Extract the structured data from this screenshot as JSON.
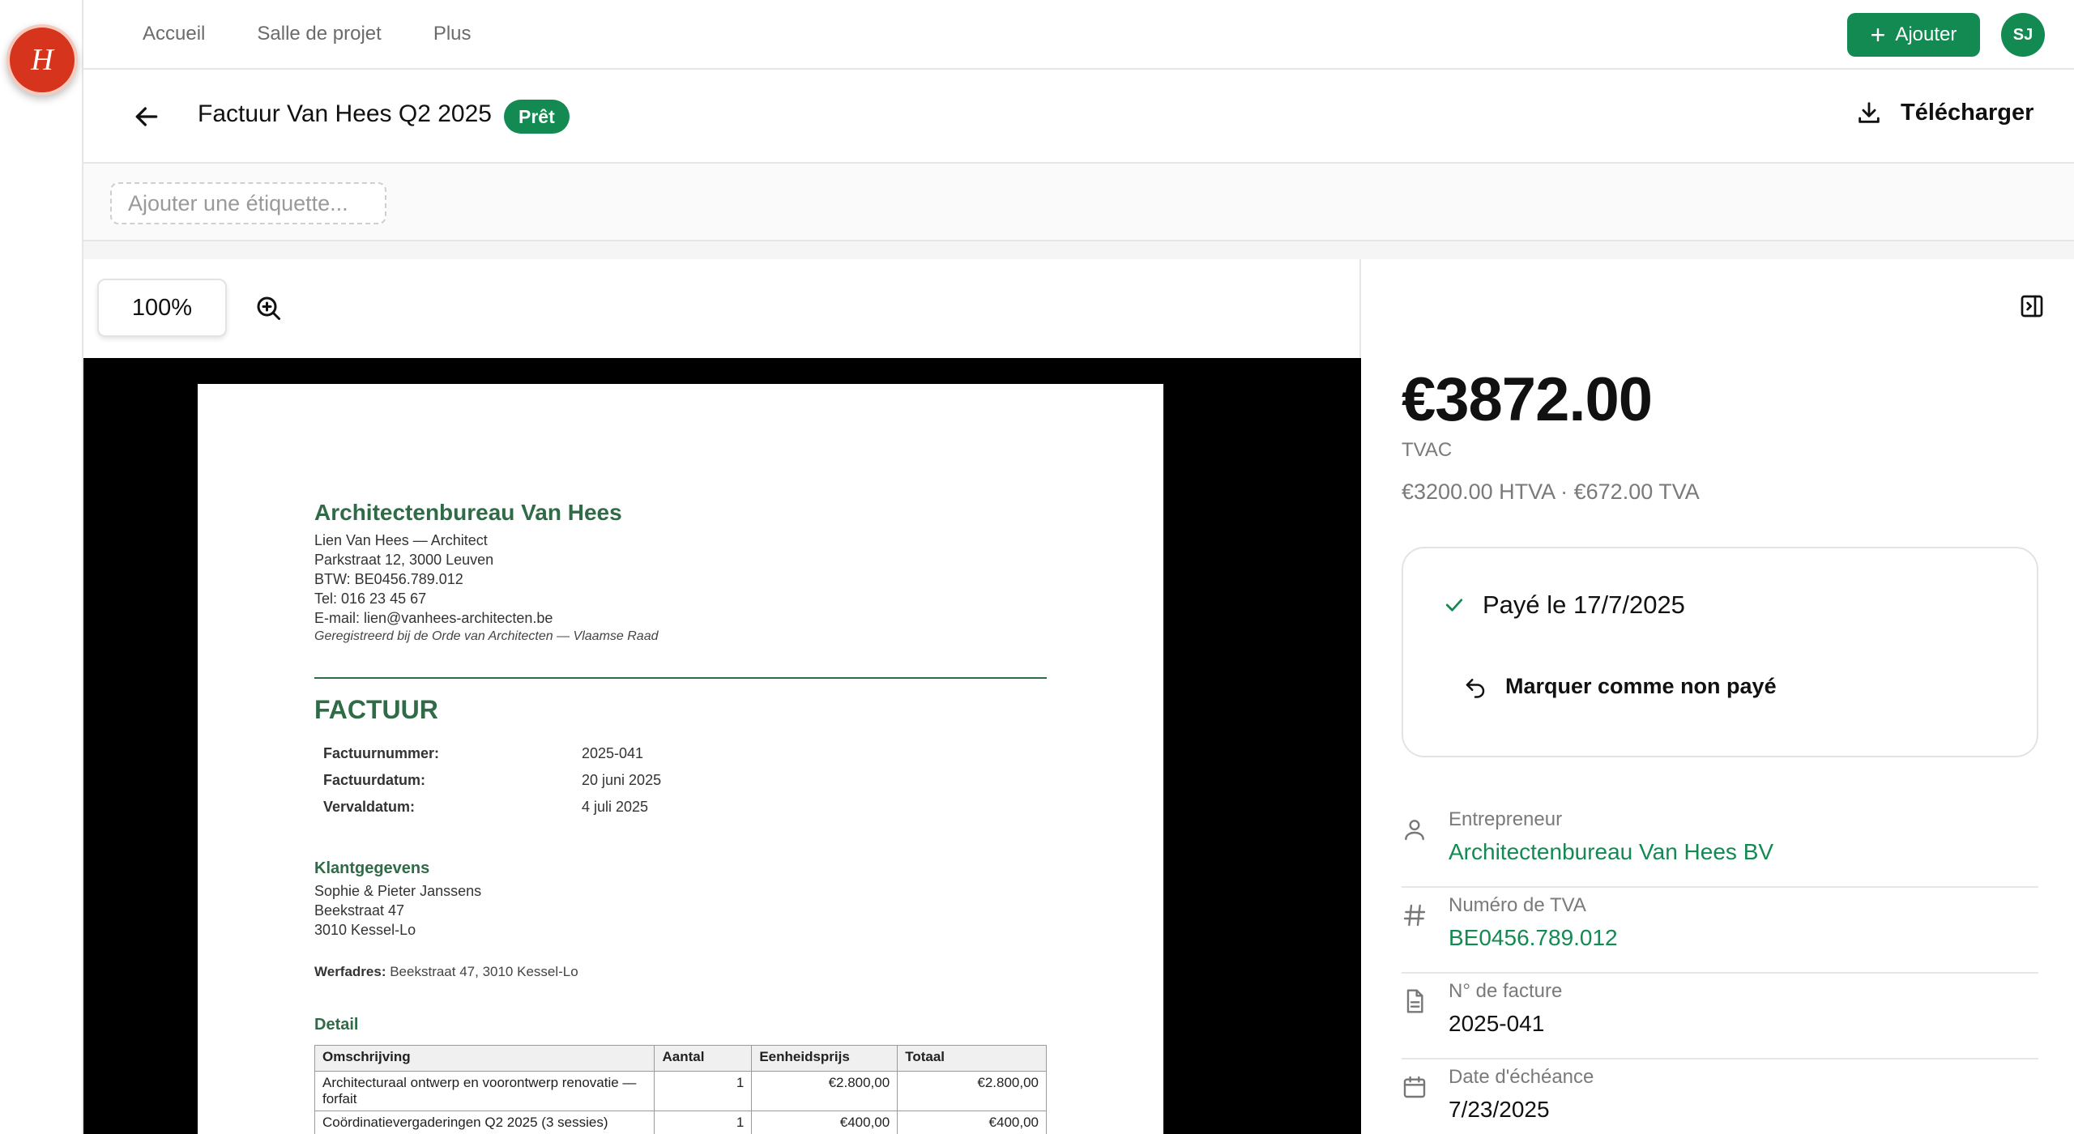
{
  "app": {
    "logo_letter": "H"
  },
  "nav": {
    "items": [
      "Accueil",
      "Salle de projet",
      "Plus"
    ],
    "add_label": "Ajouter",
    "user_initials": "SJ"
  },
  "header": {
    "title": "Factuur Van Hees Q2 2025",
    "status_badge": "Prêt",
    "download_label": "Télécharger"
  },
  "tags": {
    "placeholder": "Ajouter une étiquette..."
  },
  "viewer": {
    "zoom": "100%"
  },
  "document": {
    "company": "Architectenbureau Van Hees",
    "contact_lines": [
      "Lien Van Hees — Architect",
      "Parkstraat 12, 3000 Leuven",
      "BTW: BE0456.789.012",
      "Tel: 016 23 45 67",
      "E-mail: lien@vanhees-architecten.be"
    ],
    "registration": "Geregistreerd bij de Orde van Architecten — Vlaamse Raad",
    "heading": "FACTUUR",
    "meta": [
      {
        "label": "Factuurnummer:",
        "value": "2025-041"
      },
      {
        "label": "Factuurdatum:",
        "value": "20 juni 2025"
      },
      {
        "label": "Vervaldatum:",
        "value": "4 juli 2025"
      }
    ],
    "client_heading": "Klantgegevens",
    "client_lines": [
      "Sophie & Pieter Janssens",
      "Beekstraat 47",
      "3010 Kessel-Lo"
    ],
    "werf_label": "Werfadres:",
    "werf_value": " Beekstraat 47, 3010 Kessel-Lo",
    "detail_heading": "Detail",
    "table_headers": [
      "Omschrijving",
      "Aantal",
      "Eenheidsprijs",
      "Totaal"
    ],
    "rows": [
      {
        "desc": "Architecturaal ontwerp en voorontwerp renovatie — forfait",
        "qty": "1",
        "unit": "€2.800,00",
        "total": "€2.800,00"
      },
      {
        "desc": "Coördinatievergaderingen Q2 2025 (3 sessies)",
        "qty": "1",
        "unit": "€400,00",
        "total": "€400,00"
      }
    ]
  },
  "summary": {
    "amount": "€3872.00",
    "amount_label": "TVAC",
    "split": "€3200.00 HTVA · €672.00 TVA",
    "paid_label": "Payé le 17/7/2025",
    "unpay_label": "Marquer comme non payé"
  },
  "fields": [
    {
      "label": "Entrepreneur",
      "value": "Architectenbureau Van Hees BV",
      "icon": "person-icon"
    },
    {
      "label": "Numéro de TVA",
      "value": "BE0456.789.012",
      "icon": "hash-icon"
    },
    {
      "label": "N° de facture",
      "value": "2025-041",
      "icon": "document-icon"
    },
    {
      "label": "Date d'échéance",
      "value": "7/23/2025",
      "icon": "calendar-icon"
    }
  ],
  "colors": {
    "brand_green": "#138a52",
    "doc_green": "#2f6b46",
    "logo_red": "#d6341c"
  }
}
